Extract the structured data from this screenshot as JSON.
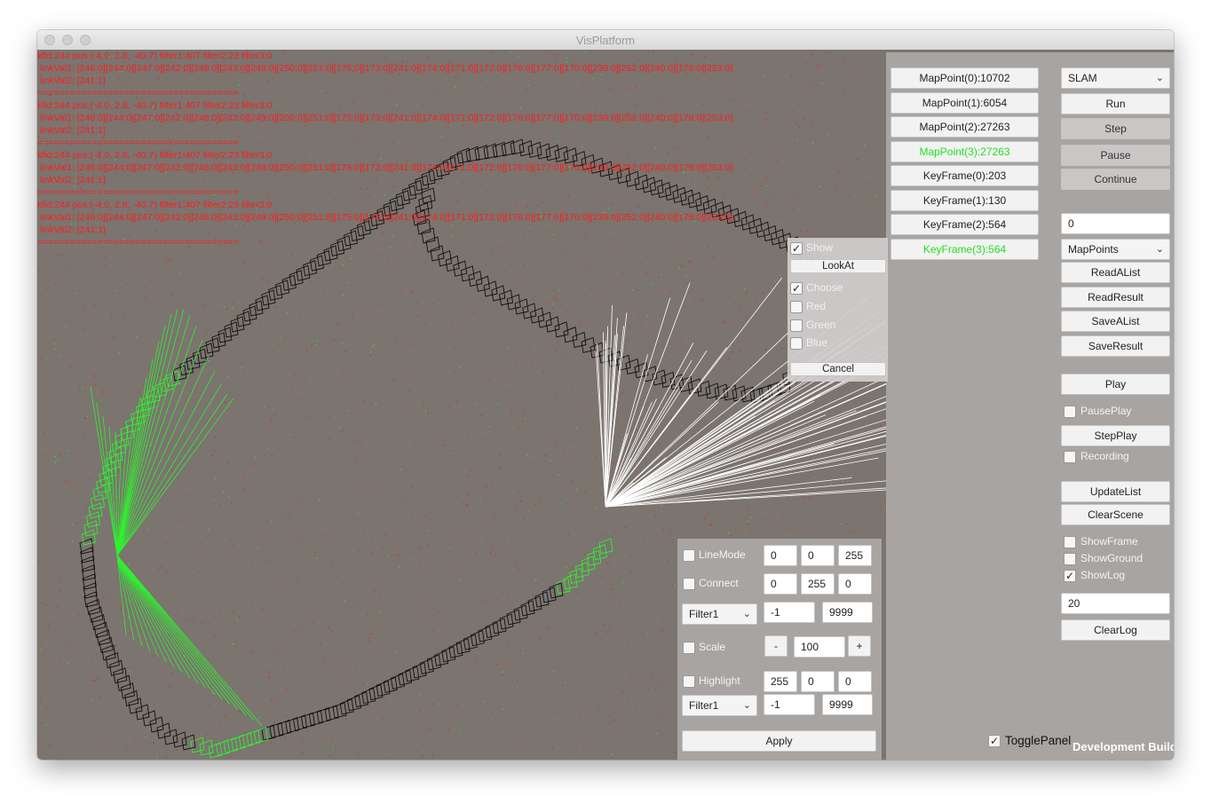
{
  "window": {
    "title": "VisPlatform"
  },
  "log_lines": [
    "kfid:244 pos:(-4.0, 2.8, -40.7) filter1:407 filter2:23 filter3:0",
    " linkVal1: [246:0][244:0][247:0][242:0][248:0][243:0][249:0][250:0][251:0][175:0][173:0][241:0][174:0][171:0][172:0][176:0][177:0][170:0][239:0][252:0][240:0][178:0][253:0]",
    " linkVal2: [241:1]",
    "=====================================",
    "kfid:244 pos:(-4.0, 2.8, -40.7) filter1:407 filter2:23 filter3:0",
    " linkVal1: [246:0][244:0][247:0][242:0][248:0][243:0][249:0][250:0][251:0][175:0][173:0][241:0][174:0][171:0][172:0][176:0][177:0][170:0][239:0][252:0][240:0][178:0][253:0]",
    " linkVal2: [241:1]",
    "=====================================",
    "kfid:244 pos:(-4.0, 2.8, -40.7) filter1:407 filter2:23 filter3:0",
    " linkVal1: [246:0][244:0][247:0][242:0][248:0][243:0][249:0][250:0][251:0][175:0][173:0][241:0][174:0][171:0][172:0][176:0][177:0][170:0][239:0][252:0][240:0][178:0][253:0]",
    " linkVal2: [241:1]",
    "=====================================",
    "kfid:244 pos:(-4.0, 2.8, -40.7) filter1:407 filter2:23 filter3:0",
    " linkVal1: [246:0][244:0][247:0][242:0][248:0][243:0][249:0][250:0][251:0][175:0][173:0][241:0][174:0][171:0][172:0][176:0][177:0][170:0][239:0][252:0][240:0][178:0][253:0]",
    " linkVal2: [241:1]",
    "====================================="
  ],
  "stats": {
    "mappoint0": "MapPoint(0):10702",
    "mappoint1": "MapPoint(1):6054",
    "mappoint2": "MapPoint(2):27263",
    "mappoint3": "MapPoint(3):27263",
    "keyframe0": "KeyFrame(0):203",
    "keyframe1": "KeyFrame(1):130",
    "keyframe2": "KeyFrame(2):564",
    "keyframe3": "KeyFrame(3):564"
  },
  "controls": {
    "mode_select": "SLAM",
    "run": "Run",
    "step": "Step",
    "pause": "Pause",
    "continue": "Continue",
    "index_value": "0",
    "list_select": "MapPoints",
    "read_alist": "ReadAList",
    "read_result": "ReadResult",
    "save_alist": "SaveAList",
    "save_result": "SaveResult",
    "play": "Play",
    "pause_play": "PausePlay",
    "step_play": "StepPlay",
    "recording": "Recording",
    "update_list": "UpdateList",
    "clear_scene": "ClearScene",
    "show_frame": "ShowFrame",
    "show_ground": "ShowGround",
    "show_log": "ShowLog",
    "log_count": "20",
    "clear_log": "ClearLog",
    "toggle_panel": "TogglePanel"
  },
  "checks": {
    "show_log": true,
    "toggle_panel": true,
    "popup_show": true,
    "popup_choose": true
  },
  "popup": {
    "show": "Show",
    "look_at": "LookAt",
    "choose": "Choose",
    "red": "Red",
    "green": "Green",
    "blue": "Blue",
    "cancel": "Cancel"
  },
  "bottom": {
    "line_mode": "LineMode",
    "line_r": "0",
    "line_g": "0",
    "line_b": "255",
    "connect": "Connect",
    "conn_r": "0",
    "conn_g": "255",
    "conn_b": "0",
    "filter_a": "Filter1",
    "filter_a_min": "-1",
    "filter_a_max": "9999",
    "scale": "Scale",
    "minus": "-",
    "scale_value": "100",
    "plus": "+",
    "highlight": "Highlight",
    "hl_r": "255",
    "hl_g": "0",
    "hl_b": "0",
    "filter_b": "Filter1",
    "filter_b_min": "-1",
    "filter_b_max": "9999",
    "apply": "Apply"
  },
  "footer": {
    "dev_build": "Development Build"
  },
  "colors": {
    "scene_bg": "#7b746f",
    "panel_bg": "#a8a4a2",
    "log_red": "#ff1c1c",
    "highlight_green": "#22e022"
  },
  "icons": [
    "chevron-down-icon",
    "checkmark-icon",
    "window-close-icon",
    "window-minimize-icon",
    "window-zoom-icon"
  ]
}
